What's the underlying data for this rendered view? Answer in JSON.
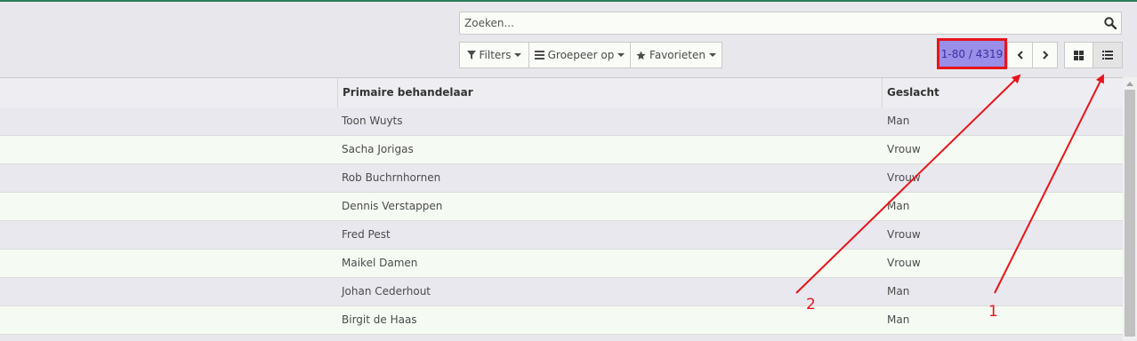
{
  "search": {
    "placeholder": "Zoeken..."
  },
  "toolbar": {
    "filters_label": "Filters",
    "groupby_label": "Groepeer op",
    "favorites_label": "Favorieten"
  },
  "pager": {
    "value": "1-80 / 4319"
  },
  "annotations": {
    "label_1": "1",
    "label_2": "2",
    "color": "#e8141a"
  },
  "table": {
    "columns": [
      "Primaire behandelaar",
      "Geslacht"
    ],
    "rows": [
      {
        "behandelaar": "Toon Wuyts",
        "geslacht": "Man"
      },
      {
        "behandelaar": "Sacha Jorigas",
        "geslacht": "Vrouw"
      },
      {
        "behandelaar": "Rob Buchrnhornen",
        "geslacht": "Vrouw"
      },
      {
        "behandelaar": "Dennis Verstappen",
        "geslacht": "Man"
      },
      {
        "behandelaar": "Fred Pest",
        "geslacht": "Vrouw"
      },
      {
        "behandelaar": "Maikel Damen",
        "geslacht": "Vrouw"
      },
      {
        "behandelaar": "Johan Cederhout",
        "geslacht": "Man"
      },
      {
        "behandelaar": "Birgit de Haas",
        "geslacht": "Man"
      }
    ]
  }
}
